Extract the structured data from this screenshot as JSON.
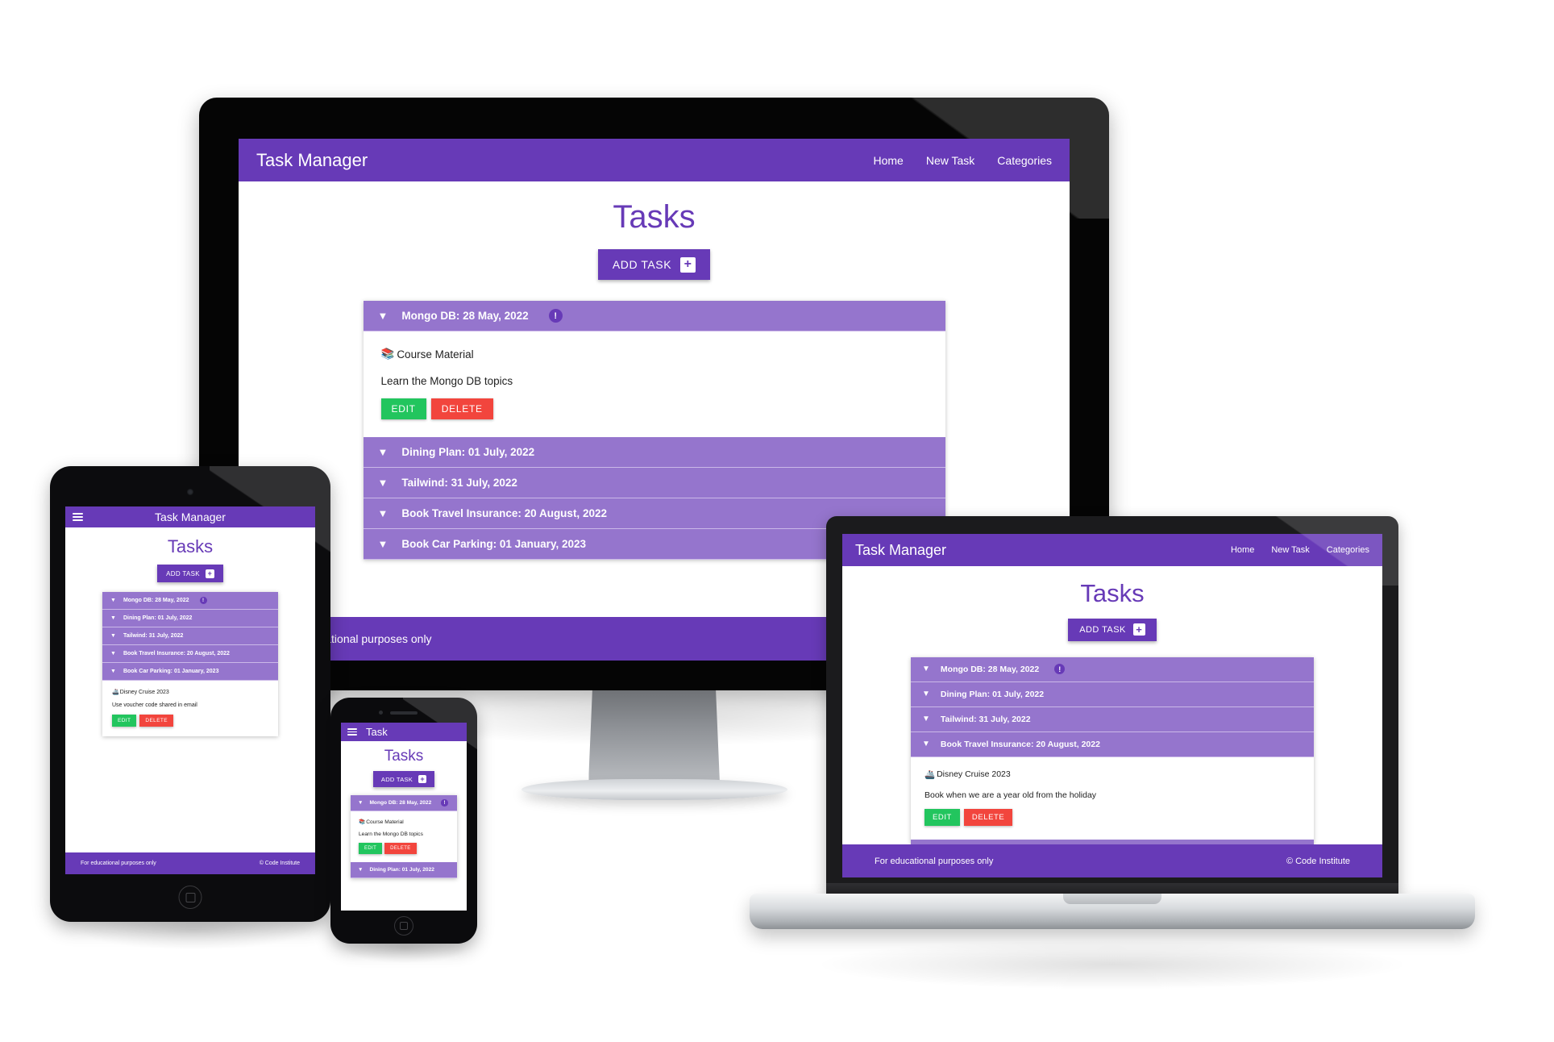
{
  "brand": "Task Manager",
  "brand_short": "Task",
  "nav": {
    "home": "Home",
    "new_task": "New Task",
    "categories": "Categories"
  },
  "page": {
    "title": "Tasks",
    "add_task": "ADD TASK",
    "plus_icon": "+"
  },
  "buttons": {
    "edit": "EDIT",
    "delete": "DELETE"
  },
  "footer": {
    "left": "For educational purposes only",
    "right": "© Code Institute"
  },
  "icons": {
    "caret": "▼",
    "urgent_badge": "!",
    "hamburger": "hamburger-icon",
    "books_emoji": "📚",
    "ship_emoji": "🚢"
  },
  "colors": {
    "primary": "#673AB7",
    "accordion_header": "#9575CD",
    "edit_green": "#22c55e",
    "delete_red": "#f2453d",
    "title_purple": "#673AB7"
  },
  "tasks": [
    {
      "title": "Mongo DB: 28 May, 2022",
      "urgent": true,
      "category": "Course Material",
      "emoji": "📚",
      "description": "Learn the Mongo DB topics"
    },
    {
      "title": "Dining Plan: 01 July, 2022",
      "urgent": false,
      "category": "",
      "emoji": "",
      "description": ""
    },
    {
      "title": "Tailwind: 31 July, 2022",
      "urgent": false,
      "category": "",
      "emoji": "",
      "description": ""
    },
    {
      "title": "Book Travel Insurance: 20 August, 2022",
      "urgent": false,
      "category": "Disney Cruise 2023",
      "emoji": "🚢",
      "description": "Book when we are a year old from the holiday"
    },
    {
      "title": "Book Car Parking: 01 January, 2023",
      "urgent": false,
      "category": "Disney Cruise 2023",
      "emoji": "🚢",
      "description": "Use voucher code shared in email"
    }
  ],
  "devices": {
    "monitor": {
      "name": "desktop-monitor",
      "expanded_index": 0
    },
    "laptop": {
      "name": "laptop",
      "expanded_index": 3
    },
    "tablet": {
      "name": "tablet",
      "expanded_index": 4
    },
    "phone": {
      "name": "phone",
      "expanded_index": 0
    }
  }
}
